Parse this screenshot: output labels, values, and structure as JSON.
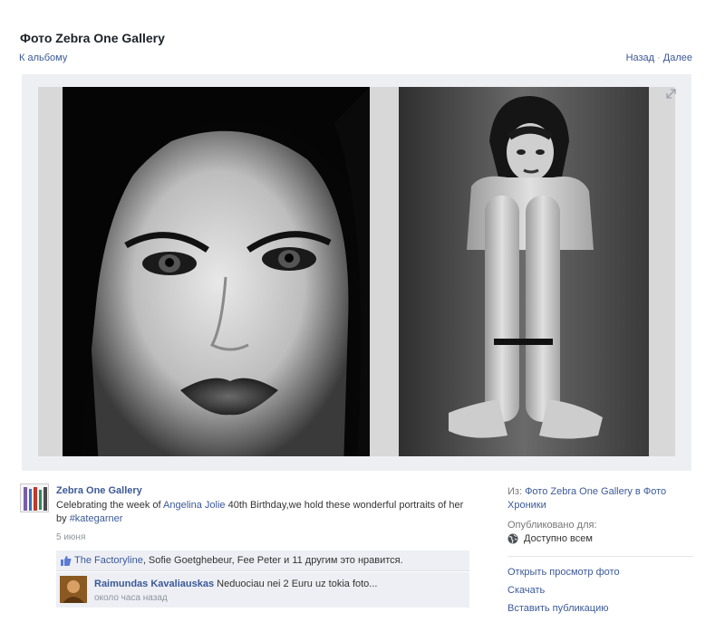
{
  "header": {
    "title": "Фото Zebra One Gallery",
    "back_link": "К альбому",
    "prev_link": "Назад",
    "separator": "·",
    "next_link": "Далее"
  },
  "post": {
    "owner_name": "Zebra One Gallery",
    "caption_part1": "Celebrating the week of ",
    "caption_link": "Angelina Jolie",
    "caption_part2": " 40th Birthday,we hold these wonderful portraits of her by ",
    "caption_hashtag": "#kategarner",
    "date": "5 июня",
    "likes_name1": "The Factoryline",
    "likes_rest": ", Sofie Goetghebeur, Fee Peter и 11 другим это нравится.",
    "comment_author": "Raimundas Kavaliauskas",
    "comment_text": " Neduociau nei 2 Euru uz tokia foto...",
    "comment_time": "около часа назад"
  },
  "sidebar": {
    "from_label": "Из: ",
    "from_link": "Фото Zebra One Gallery в Фото Хроники",
    "published_label": "Опубликовано для:",
    "privacy_value": "Доступно всем",
    "actions": [
      "Открыть просмотр фото",
      "Скачать",
      "Вставить публикацию"
    ]
  },
  "colors": {
    "link": "#3b5998",
    "stage_bg": "#eeeff2",
    "box_bg": "#edeff4"
  },
  "icons": {
    "expand": "expand-icon",
    "like": "like-icon",
    "globe": "globe-icon"
  }
}
